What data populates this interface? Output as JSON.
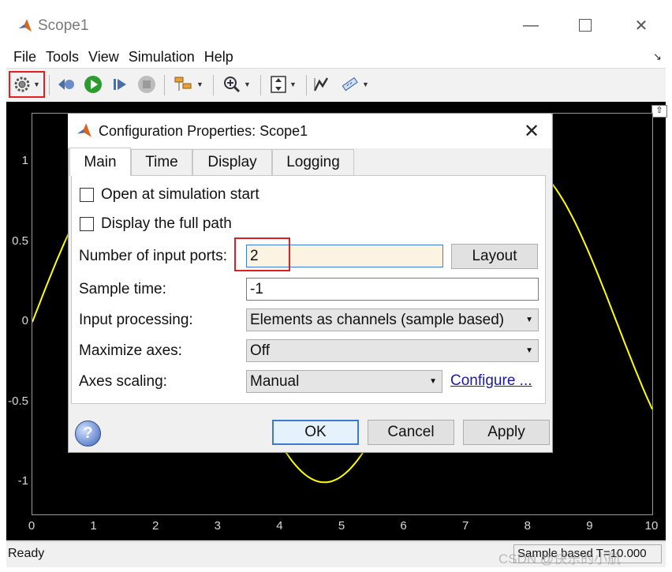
{
  "window": {
    "title": "Scope1"
  },
  "menu": [
    "File",
    "Tools",
    "View",
    "Simulation",
    "Help"
  ],
  "toolbar": {
    "icons": [
      "gear-icon",
      "step-back-icon",
      "run-icon",
      "step-forward-icon",
      "stop-icon",
      "layout-icon",
      "zoom-icon",
      "autoscale-icon",
      "cursor-icon",
      "measure-icon"
    ]
  },
  "plot": {
    "y_ticks": [
      "1",
      "0.5",
      "0",
      "-0.5",
      "-1"
    ],
    "x_ticks": [
      "0",
      "1",
      "2",
      "3",
      "4",
      "5",
      "6",
      "7",
      "8",
      "9",
      "10"
    ],
    "line_color": "#ffff00",
    "background": "#000000"
  },
  "chart_data": {
    "type": "line",
    "series": [
      {
        "function": "sin",
        "x": [
          0,
          0.5,
          1,
          1.5,
          2,
          2.5,
          3,
          3.5,
          4,
          4.5,
          5,
          5.5,
          6,
          6.5,
          7,
          7.5,
          8,
          8.5,
          9,
          9.5,
          10
        ],
        "y": [
          0,
          0.479,
          0.841,
          0.997,
          0.909,
          0.598,
          0.141,
          -0.351,
          -0.757,
          -0.978,
          -0.959,
          -0.706,
          -0.279,
          0.215,
          0.657,
          0.938,
          0.989,
          0.798,
          0.412,
          -0.075,
          -0.544
        ]
      }
    ],
    "xlim": [
      0,
      10
    ],
    "ylim": [
      -1.2,
      1.3
    ],
    "grid": false
  },
  "status": {
    "left": "Ready",
    "right": "Sample based  T=10.000",
    "watermark": "CSDN @快乐的小航"
  },
  "dialog": {
    "title": "Configuration Properties: Scope1",
    "tabs": [
      "Main",
      "Time",
      "Display",
      "Logging"
    ],
    "active_tab": "Main",
    "open_at_start": "Open at simulation start",
    "display_full_path": "Display the full path",
    "num_ports_label": "Number of input ports:",
    "num_ports_value": "2",
    "layout_button": "Layout",
    "sample_time_label": "Sample time:",
    "sample_time_value": "-1",
    "input_processing_label": "Input processing:",
    "input_processing_value": "Elements as channels (sample based)",
    "maximize_axes_label": "Maximize axes:",
    "maximize_axes_value": "Off",
    "axes_scaling_label": "Axes scaling:",
    "axes_scaling_value": "Manual",
    "configure_link": "Configure ...",
    "ok": "OK",
    "cancel": "Cancel",
    "apply": "Apply"
  }
}
